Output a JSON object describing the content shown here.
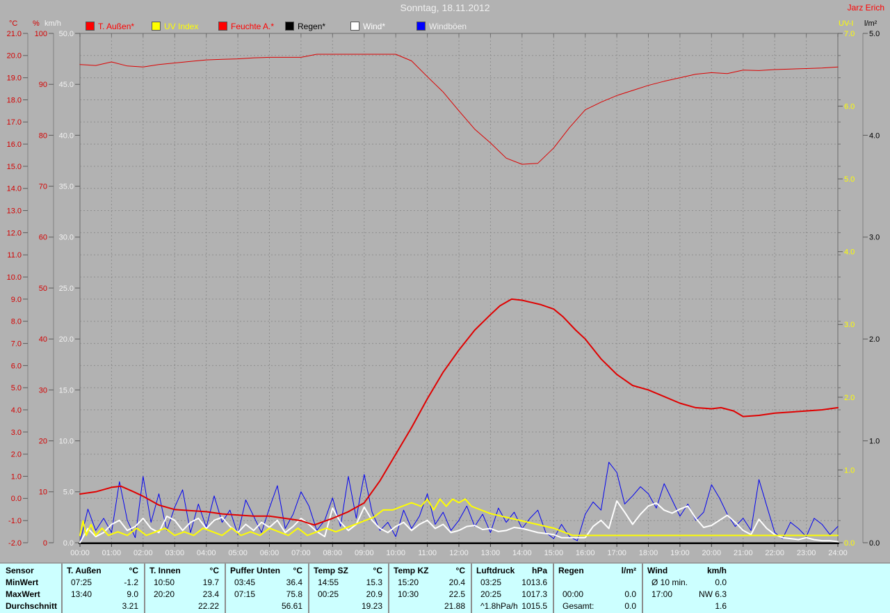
{
  "header": {
    "title": "Sonntag, 18.11.2012",
    "user": "Jarz Erich"
  },
  "axis_headers": {
    "celsius": "°C",
    "percent": "%",
    "kmh": "km/h",
    "uv": "UV-I",
    "lm2": "l/m²"
  },
  "legend": [
    {
      "label": "T. Außen*",
      "swatch": "#ff0000",
      "text_color": "#ff0000"
    },
    {
      "label": "UV Index",
      "swatch": "#ffff00",
      "text_color": "#ffff00"
    },
    {
      "label": "Feuchte A.*",
      "swatch": "#ff0000",
      "text_color": "#ff0000"
    },
    {
      "label": "Regen*",
      "swatch": "#000000",
      "text_color": "#000000"
    },
    {
      "label": "Wind*",
      "swatch": "#ffffff",
      "text_color": "#ffffff"
    },
    {
      "label": "Windböen",
      "swatch": "#0000ff",
      "text_color": "#f0f0f0"
    }
  ],
  "chart_data": {
    "type": "line",
    "title": "Sonntag, 18.11.2012",
    "x_unit": "hours",
    "grid": true,
    "x_ticks": [
      "00:00",
      "01:00",
      "02:00",
      "03:00",
      "04:00",
      "05:00",
      "06:00",
      "07:00",
      "08:00",
      "09:00",
      "10:00",
      "11:00",
      "12:00",
      "13:00",
      "14:00",
      "15:00",
      "16:00",
      "17:00",
      "18:00",
      "19:00",
      "20:00",
      "21:00",
      "22:00",
      "23:00",
      "24:00"
    ],
    "axes": {
      "celsius": {
        "label": "°C",
        "min": -2,
        "max": 21,
        "ticks": [
          "21.0",
          "20.0",
          "19.0",
          "18.0",
          "17.0",
          "16.0",
          "15.0",
          "14.0",
          "13.0",
          "12.0",
          "11.0",
          "10.0",
          "9.0",
          "8.0",
          "7.0",
          "6.0",
          "5.0",
          "4.0",
          "3.0",
          "2.0",
          "1.0",
          "0.0",
          "-1.0",
          "-2.0"
        ]
      },
      "percent": {
        "label": "%",
        "min": 0,
        "max": 100,
        "ticks": [
          "100",
          "90",
          "80",
          "70",
          "60",
          "50",
          "40",
          "30",
          "20",
          "10",
          "0"
        ]
      },
      "kmh": {
        "label": "km/h",
        "min": 0,
        "max": 50,
        "ticks": [
          "50.0",
          "45.0",
          "40.0",
          "35.0",
          "30.0",
          "25.0",
          "20.0",
          "15.0",
          "10.0",
          "5.0",
          "0.0"
        ]
      },
      "uv": {
        "label": "UV-I",
        "min": 0,
        "max": 7,
        "ticks": [
          "7.0",
          "6.0",
          "5.0",
          "4.0",
          "3.0",
          "2.0",
          "1.0",
          "0.0"
        ]
      },
      "lm2": {
        "label": "l/m²",
        "min": 0,
        "max": 5,
        "ticks": [
          "5.0",
          "4.0",
          "3.0",
          "2.0",
          "1.0",
          "0.0"
        ]
      }
    },
    "series": [
      {
        "name": "Regen",
        "axis": "lm2",
        "color": "#000000",
        "width": 1,
        "x": [
          0,
          24
        ],
        "values": [
          0.0,
          0.0
        ]
      },
      {
        "name": "Windböen",
        "axis": "kmh",
        "color": "#0000f0",
        "width": 1,
        "x_start": 0,
        "x_step": 0.25,
        "values": [
          0.0,
          3.3,
          1.2,
          2.4,
          1.0,
          6.0,
          2.2,
          0.5,
          6.5,
          2.0,
          4.8,
          1.2,
          3.5,
          5.2,
          1.0,
          3.8,
          1.5,
          4.6,
          2.0,
          3.2,
          0.8,
          4.2,
          2.6,
          1.0,
          3.4,
          5.6,
          1.4,
          2.8,
          5.0,
          3.6,
          1.2,
          2.2,
          4.4,
          1.6,
          6.5,
          2.4,
          6.7,
          3.0,
          1.2,
          2.0,
          0.6,
          3.2,
          1.4,
          2.6,
          4.8,
          1.8,
          3.0,
          1.2,
          2.2,
          3.6,
          1.6,
          2.8,
          1.0,
          3.4,
          2.0,
          3.0,
          1.4,
          2.4,
          3.2,
          1.0,
          0.4,
          1.8,
          0.6,
          0.2,
          2.8,
          4.0,
          3.2,
          7.9,
          6.9,
          3.8,
          4.6,
          5.5,
          4.8,
          3.4,
          5.8,
          4.2,
          2.6,
          3.8,
          2.2,
          3.0,
          5.7,
          4.4,
          2.8,
          1.6,
          2.4,
          1.2,
          6.2,
          3.6,
          1.0,
          0.4,
          2.0,
          1.4,
          0.6,
          2.4,
          1.8,
          0.8,
          1.6
        ]
      },
      {
        "name": "Wind",
        "axis": "kmh",
        "color": "#ffffff",
        "width": 2,
        "x_start": 0,
        "x_step": 0.25,
        "values": [
          0.0,
          1.4,
          0.6,
          1.0,
          1.8,
          2.2,
          1.2,
          1.6,
          2.4,
          1.4,
          1.0,
          2.6,
          2.2,
          1.2,
          2.0,
          2.4,
          1.4,
          2.2,
          2.5,
          1.6,
          1.0,
          1.8,
          1.2,
          2.0,
          1.5,
          2.2,
          1.0,
          1.6,
          2.4,
          1.8,
          1.1,
          0.6,
          3.4,
          2.0,
          1.2,
          1.8,
          3.5,
          2.2,
          1.4,
          1.0,
          1.6,
          2.0,
          1.2,
          1.8,
          2.2,
          1.4,
          1.8,
          1.0,
          1.2,
          1.6,
          1.7,
          1.3,
          1.4,
          1.1,
          1.2,
          1.5,
          1.4,
          1.2,
          1.0,
          0.9,
          0.8,
          0.5,
          0.5,
          0.5,
          0.5,
          1.6,
          2.2,
          1.4,
          4.1,
          3.0,
          1.8,
          2.8,
          3.6,
          3.9,
          3.2,
          2.9,
          3.3,
          3.6,
          2.4,
          1.5,
          1.7,
          2.2,
          2.7,
          2.0,
          1.2,
          0.8,
          2.3,
          1.4,
          0.8,
          0.5,
          0.4,
          0.3,
          0.5,
          0.3,
          0.2,
          0.2,
          0.1
        ]
      },
      {
        "name": "UV Index",
        "axis": "uv",
        "color": "#ffff00",
        "width": 2,
        "x": [
          0,
          0.1,
          0.2,
          0.35,
          0.5,
          0.7,
          0.9,
          1.2,
          1.5,
          1.8,
          2.1,
          2.4,
          2.7,
          3.0,
          3.3,
          3.6,
          3.9,
          4.2,
          4.5,
          4.8,
          5.1,
          5.4,
          5.7,
          6.0,
          6.3,
          6.6,
          6.9,
          7.2,
          7.5,
          7.8,
          8.1,
          8.4,
          8.7,
          9.0,
          9.3,
          9.6,
          9.9,
          10.2,
          10.5,
          10.8,
          11.0,
          11.2,
          11.4,
          11.6,
          11.8,
          12.0,
          12.2,
          12.4,
          12.7,
          13.0,
          13.5,
          14.0,
          14.5,
          15.0,
          15.3,
          15.6,
          16.0,
          17.0,
          18.0,
          19.0,
          20.0,
          21.0,
          22.0,
          23.0,
          24.0
        ],
        "values": [
          0.1,
          0.3,
          0.1,
          0.25,
          0.1,
          0.2,
          0.1,
          0.15,
          0.1,
          0.2,
          0.1,
          0.15,
          0.2,
          0.1,
          0.15,
          0.1,
          0.2,
          0.15,
          0.1,
          0.2,
          0.1,
          0.15,
          0.1,
          0.2,
          0.15,
          0.1,
          0.2,
          0.1,
          0.15,
          0.2,
          0.15,
          0.2,
          0.25,
          0.3,
          0.35,
          0.45,
          0.45,
          0.5,
          0.55,
          0.5,
          0.6,
          0.45,
          0.6,
          0.5,
          0.6,
          0.55,
          0.6,
          0.5,
          0.45,
          0.4,
          0.35,
          0.3,
          0.25,
          0.2,
          0.15,
          0.1,
          0.1,
          0.1,
          0.1,
          0.1,
          0.1,
          0.1,
          0.1,
          0.1,
          0.1
        ]
      },
      {
        "name": "Feuchte A.",
        "axis": "percent",
        "color": "#dd0000",
        "width": 1,
        "x_start": 0,
        "x_step": 0.5,
        "values": [
          93.9,
          93.7,
          94.4,
          93.6,
          93.4,
          93.9,
          94.2,
          94.5,
          94.8,
          94.9,
          95.0,
          95.2,
          95.3,
          95.3,
          95.3,
          95.9,
          95.9,
          95.9,
          95.9,
          95.9,
          95.9,
          94.6,
          91.5,
          88.5,
          84.8,
          81.2,
          78.5,
          75.5,
          74.3,
          74.5,
          77.5,
          81.5,
          85.0,
          86.5,
          87.8,
          88.8,
          89.8,
          90.6,
          91.3,
          92.0,
          92.3,
          92.1,
          92.8,
          92.7,
          92.9,
          93.0,
          93.1,
          93.2,
          93.4
        ]
      },
      {
        "name": "T. Außen",
        "axis": "celsius",
        "color": "#e00000",
        "width": 2,
        "x": [
          0,
          0.5,
          1.0,
          1.3,
          1.7,
          2.0,
          2.5,
          3.0,
          3.5,
          4.0,
          4.5,
          5.0,
          5.5,
          6.0,
          6.5,
          7.0,
          7.2,
          7.42,
          7.7,
          8.0,
          8.5,
          9.0,
          9.5,
          10.0,
          10.5,
          11.0,
          11.5,
          12.0,
          12.5,
          13.0,
          13.3,
          13.67,
          14.0,
          14.3,
          14.6,
          15.0,
          15.3,
          15.7,
          16.0,
          16.5,
          17.0,
          17.5,
          18.0,
          18.5,
          19.0,
          19.5,
          20.0,
          20.3,
          20.7,
          21.0,
          21.5,
          22.0,
          22.5,
          23.0,
          23.5,
          24.0
        ],
        "values": [
          0.2,
          0.3,
          0.5,
          0.55,
          0.3,
          0.1,
          -0.3,
          -0.5,
          -0.55,
          -0.6,
          -0.7,
          -0.75,
          -0.8,
          -0.8,
          -0.9,
          -1.0,
          -1.1,
          -1.2,
          -1.05,
          -0.9,
          -0.6,
          -0.2,
          0.8,
          2.0,
          3.2,
          4.5,
          5.7,
          6.7,
          7.6,
          8.3,
          8.7,
          9.0,
          8.95,
          8.85,
          8.75,
          8.55,
          8.2,
          7.6,
          7.2,
          6.3,
          5.6,
          5.1,
          4.9,
          4.6,
          4.3,
          4.1,
          4.05,
          4.1,
          3.95,
          3.7,
          3.75,
          3.85,
          3.9,
          3.95,
          4.0,
          4.1
        ]
      }
    ]
  },
  "table": {
    "row_labels": [
      "Sensor",
      "MinWert",
      "MaxWert",
      "Durchschnitt"
    ],
    "groups": [
      {
        "name": "T. Außen",
        "unit": "°C",
        "min": [
          "07:25",
          "-1.2"
        ],
        "max": [
          "13:40",
          "9.0"
        ],
        "avg": [
          "",
          "3.21"
        ]
      },
      {
        "name": "T. Innen",
        "unit": "°C",
        "min": [
          "10:50",
          "19.7"
        ],
        "max": [
          "20:20",
          "23.4"
        ],
        "avg": [
          "",
          "22.22"
        ]
      },
      {
        "name": "Puffer Unten",
        "unit": "°C",
        "min": [
          "03:45",
          "36.4"
        ],
        "max": [
          "07:15",
          "75.8"
        ],
        "avg": [
          "",
          "56.61"
        ]
      },
      {
        "name": "Temp SZ",
        "unit": "°C",
        "min": [
          "14:55",
          "15.3"
        ],
        "max": [
          "00:25",
          "20.9"
        ],
        "avg": [
          "",
          "19.23"
        ]
      },
      {
        "name": "Temp KZ",
        "unit": "°C",
        "min": [
          "15:20",
          "20.4"
        ],
        "max": [
          "10:30",
          "22.5"
        ],
        "avg": [
          "",
          "21.88"
        ]
      },
      {
        "name": "Luftdruck",
        "unit": "hPa",
        "min": [
          "03:25",
          "1013.6"
        ],
        "max": [
          "20:25",
          "1017.3"
        ],
        "avg": [
          "^1.8hPa/h",
          "1015.5"
        ]
      },
      {
        "name": "Regen",
        "unit": "l/m²",
        "min": [
          "",
          ""
        ],
        "max": [
          "00:00",
          "0.0"
        ],
        "avg": [
          "Gesamt:",
          "0.0"
        ]
      },
      {
        "name": "Wind",
        "unit": "km/h",
        "min": [
          "Ø 10 min.",
          "0.0"
        ],
        "max": [
          "17:00",
          "NW 6.3"
        ],
        "avg": [
          "",
          "1.6"
        ]
      }
    ]
  }
}
